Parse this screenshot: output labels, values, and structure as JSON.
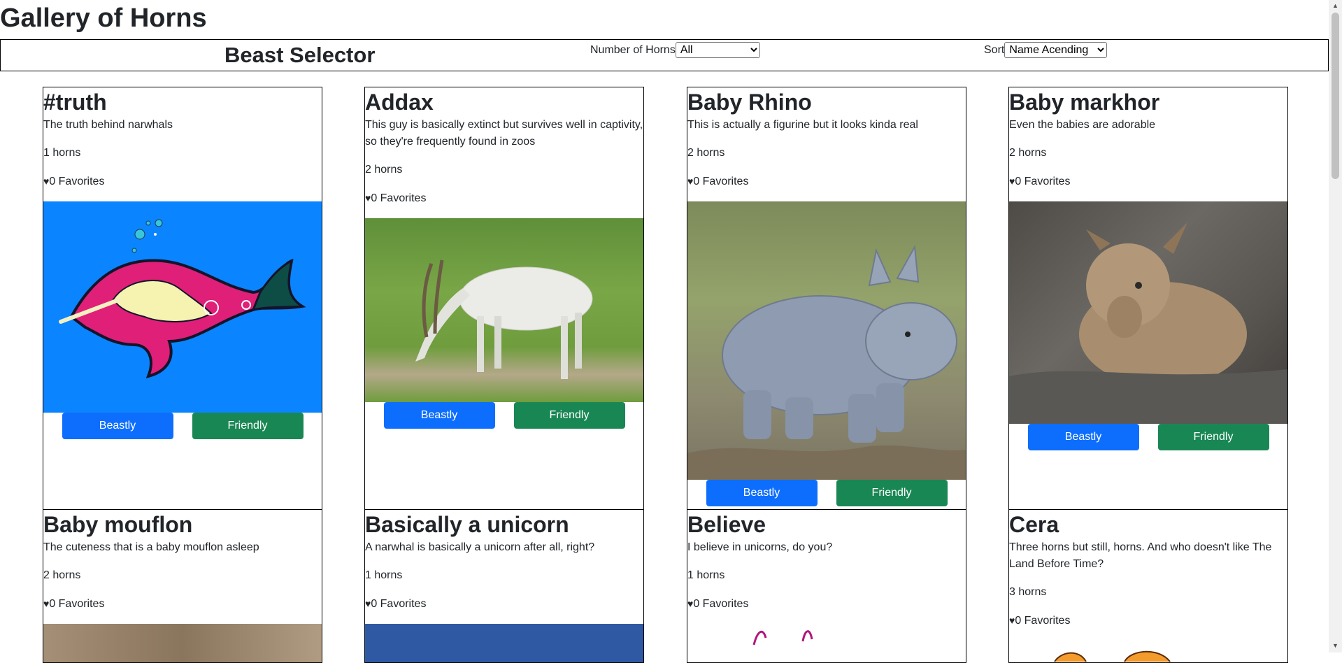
{
  "page": {
    "title": "Gallery of Horns"
  },
  "selector": {
    "title": "Beast Selector",
    "horns_label": "Number of Horns",
    "horns_value": "All",
    "sort_label": "Sort",
    "sort_value": "Name Acending"
  },
  "buttons": {
    "beastly": "Beastly",
    "friendly": "Friendly"
  },
  "cards": [
    {
      "title": "#truth",
      "description": "The truth behind narwhals",
      "horns": "1 horns",
      "favorites": "0 Favorites",
      "image": "narwhal-unicorn-cartoon"
    },
    {
      "title": "Addax",
      "description": "This guy is basically extinct but survives well in captivity, so they're frequently found in zoos",
      "horns": "2 horns",
      "favorites": "0 Favorites",
      "image": "addax-grazing-photo"
    },
    {
      "title": "Baby Rhino",
      "description": "This is actually a figurine but it looks kinda real",
      "horns": "2 horns",
      "favorites": "0 Favorites",
      "image": "baby-rhino-figurine-photo"
    },
    {
      "title": "Baby markhor",
      "description": "Even the babies are adorable",
      "horns": "2 horns",
      "favorites": "0 Favorites",
      "image": "baby-markhor-photo"
    },
    {
      "title": "Baby mouflon",
      "description": "The cuteness that is a baby mouflon asleep",
      "horns": "2 horns",
      "favorites": "0 Favorites",
      "image": "baby-mouflon-photo"
    },
    {
      "title": "Basically a unicorn",
      "description": "A narwhal is basically a unicorn after all, right?",
      "horns": "1 horns",
      "favorites": "0 Favorites",
      "image": "narwhal-blue-illustration"
    },
    {
      "title": "Believe",
      "description": "I believe in unicorns, do you?",
      "horns": "1 horns",
      "favorites": "0 Favorites",
      "image": "unicorn-drawing"
    },
    {
      "title": "Cera",
      "description": "Three horns but still, horns. And who doesn't like The Land Before Time?",
      "horns": "3 horns",
      "favorites": "0 Favorites",
      "image": "triceratops-cartoon"
    }
  ],
  "colors": {
    "beastly": "#0d6efd",
    "friendly": "#198754",
    "narwhal_bg": "#0a84ff"
  }
}
